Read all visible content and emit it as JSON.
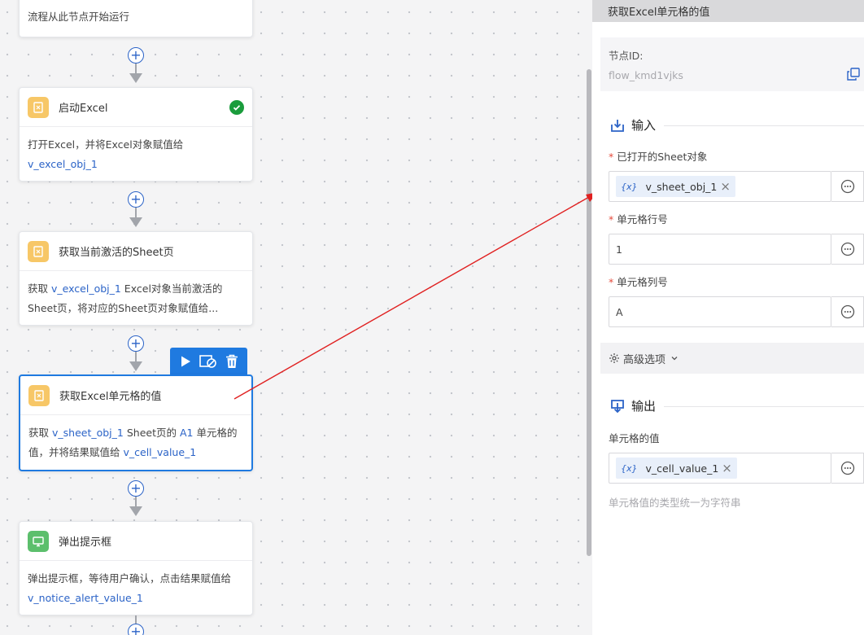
{
  "flow": {
    "partial_card": {
      "desc": "流程从此节点开始运行"
    },
    "cards": [
      {
        "title": "启动Excel",
        "desc_pre": "打开Excel，并将Excel对象赋值给",
        "var": "v_excel_obj_1"
      },
      {
        "title": "获取当前激活的Sheet页",
        "desc_pre": "获取 ",
        "var": "v_excel_obj_1",
        "desc_post": " Excel对象当前激活的Sheet页，将对应的Sheet页对象赋值给..."
      },
      {
        "title": "获取Excel单元格的值",
        "desc_pre": "获取 ",
        "var1": "v_sheet_obj_1",
        "desc_mid1": " Sheet页的 ",
        "var2": "A1",
        "desc_mid2": " 单元格的值，并将结果赋值给 ",
        "var3": "v_cell_value_1"
      },
      {
        "title": "弹出提示框",
        "desc_pre": "弹出提示框，等待用户确认，点击结果赋值给 ",
        "var": "v_notice_alert_value_1"
      }
    ],
    "plus_symbol": "+"
  },
  "panel": {
    "header": "获取Excel单元格的值",
    "node_label": "节点ID:",
    "node_id": "flow_kmd1vjks",
    "input_title": "输入",
    "output_title": "输出",
    "required_mark": "*",
    "fields": [
      {
        "label": "已打开的Sheet对象",
        "var_icon": "{x}",
        "value": "v_sheet_obj_1",
        "close": "×"
      },
      {
        "label": "单元格行号",
        "value": "1"
      },
      {
        "label": "单元格列号",
        "value": "A"
      }
    ],
    "advanced": "高级选项",
    "output_field": {
      "label": "单元格的值",
      "var_icon": "{x}",
      "value": "v_cell_value_1",
      "close": "×"
    },
    "hint": "单元格值的类型统一为字符串"
  },
  "colors": {
    "accent": "#1f7ae0",
    "variable": "#2b63c7",
    "success": "#1a9c3c",
    "required": "#e54b3c",
    "annotation": "#e02020"
  }
}
